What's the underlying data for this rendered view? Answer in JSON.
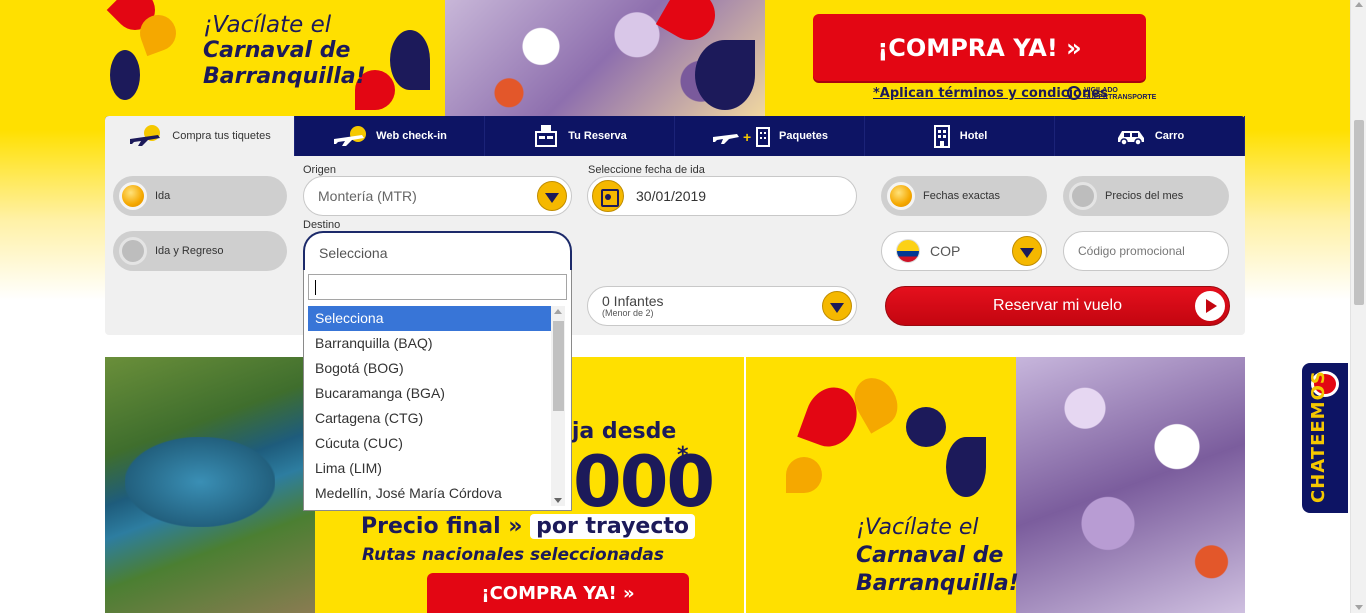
{
  "top_banner": {
    "title_line1": "¡Vacílate el",
    "title_line2": "Carnaval de",
    "title_line3": "Barranquilla!",
    "cta_label": "¡COMPRA YA!  »",
    "terms_label": "*Aplican términos y condiciones",
    "vigilado_label": "VIGILADO SUPERTRANSPORTE"
  },
  "tabs": [
    {
      "label": "Compra tus tiquetes",
      "icon": "plane-cloud-icon"
    },
    {
      "label": "Web check-in",
      "icon": "plane-checkin-icon"
    },
    {
      "label": "Tu Reserva",
      "icon": "reservation-desk-icon"
    },
    {
      "label": "Paquetes",
      "icon": "plane-hotel-icon"
    },
    {
      "label": "Hotel",
      "icon": "building-icon"
    },
    {
      "label": "Carro",
      "icon": "car-icon"
    }
  ],
  "search": {
    "trip_type": {
      "ida": "Ida",
      "ida_regreso": "Ida y Regreso",
      "selected": "Ida"
    },
    "origin_label": "Origen",
    "origin_value": "Montería (MTR)",
    "destination_label": "Destino",
    "destination_value": "Selecciona",
    "destination_options": [
      "Selecciona",
      "Barranquilla (BAQ)",
      "Bogotá (BOG)",
      "Bucaramanga (BGA)",
      "Cartagena (CTG)",
      "Cúcuta (CUC)",
      "Lima (LIM)",
      "Medellín, José María Córdova"
    ],
    "date_label": "Seleccione fecha de ida",
    "date_value": "30/01/2019",
    "infants_value": "0 Infantes",
    "infants_sub": "(Menor de 2)",
    "exact_dates_label": "Fechas exactas",
    "month_prices_label": "Precios del mes",
    "currency_value": "COP",
    "promo_placeholder": "Código promocional",
    "reserve_label": "Reservar mi vuelo"
  },
  "promo_left": {
    "text_partial": "aja desde",
    "price_partial": "000",
    "asterisk": "*",
    "precio_final": "Precio final »",
    "por_trayecto": "por trayecto",
    "rutas": "Rutas nacionales seleccionadas",
    "cta_label": "¡COMPRA YA!  »"
  },
  "promo_right": {
    "title_line1": "¡Vacílate el",
    "title_line2": "Carnaval de",
    "title_line3": "Barranquilla!"
  },
  "chat": {
    "label": "CHATEEMOS"
  },
  "colors": {
    "brand_yellow": "#ffe000",
    "brand_navy": "#0d1464",
    "brand_red": "#e30613",
    "selection_blue": "#3875d7"
  }
}
